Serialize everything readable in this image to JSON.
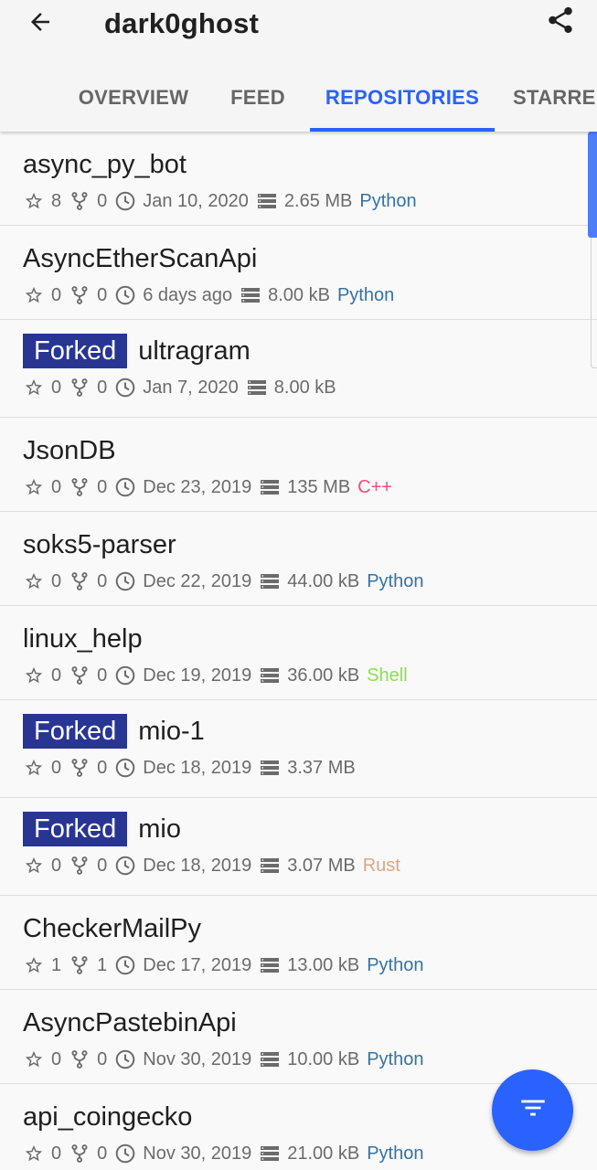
{
  "header": {
    "title": "dark0ghost",
    "back_icon": "arrow-back-icon",
    "share_icon": "share-icon"
  },
  "tabs": [
    {
      "label": "OVERVIEW",
      "active": false
    },
    {
      "label": "FEED",
      "active": false
    },
    {
      "label": "REPOSITORIES",
      "active": true
    },
    {
      "label": "STARRED",
      "active": false
    }
  ],
  "colors": {
    "accent": "#2962ff",
    "fork_badge": "#283593",
    "python": "#3572a5",
    "cpp": "#f34b7d",
    "shell": "#89e051",
    "rust": "#dea584"
  },
  "repos": [
    {
      "name": "async_py_bot",
      "forked": false,
      "stars": "8",
      "forks": "0",
      "date": "Jan 10, 2020",
      "size": "2.65 MB",
      "language": "Python"
    },
    {
      "name": "AsyncEtherScanApi",
      "forked": false,
      "stars": "0",
      "forks": "0",
      "date": "6 days ago",
      "size": "8.00 kB",
      "language": "Python"
    },
    {
      "name": "ultragram",
      "forked": true,
      "fork_label": "Forked",
      "stars": "0",
      "forks": "0",
      "date": "Jan 7, 2020",
      "size": "8.00 kB",
      "language": ""
    },
    {
      "name": "JsonDB",
      "forked": false,
      "stars": "0",
      "forks": "0",
      "date": "Dec 23, 2019",
      "size": "135 MB",
      "language": "C++"
    },
    {
      "name": "soks5-parser",
      "forked": false,
      "stars": "0",
      "forks": "0",
      "date": "Dec 22, 2019",
      "size": "44.00 kB",
      "language": "Python"
    },
    {
      "name": "linux_help",
      "forked": false,
      "stars": "0",
      "forks": "0",
      "date": "Dec 19, 2019",
      "size": "36.00 kB",
      "language": "Shell"
    },
    {
      "name": "mio-1",
      "forked": true,
      "fork_label": "Forked",
      "stars": "0",
      "forks": "0",
      "date": "Dec 18, 2019",
      "size": "3.37 MB",
      "language": ""
    },
    {
      "name": "mio",
      "forked": true,
      "fork_label": "Forked",
      "stars": "0",
      "forks": "0",
      "date": "Dec 18, 2019",
      "size": "3.07 MB",
      "language": "Rust"
    },
    {
      "name": "CheckerMailPy",
      "forked": false,
      "stars": "1",
      "forks": "1",
      "date": "Dec 17, 2019",
      "size": "13.00 kB",
      "language": "Python"
    },
    {
      "name": "AsyncPastebinApi",
      "forked": false,
      "stars": "0",
      "forks": "0",
      "date": "Nov 30, 2019",
      "size": "10.00 kB",
      "language": "Python"
    },
    {
      "name": "api_coingecko",
      "forked": false,
      "stars": "0",
      "forks": "0",
      "date": "Nov 30, 2019",
      "size": "21.00 kB",
      "language": "Python"
    }
  ],
  "fab": {
    "icon": "filter-icon"
  }
}
